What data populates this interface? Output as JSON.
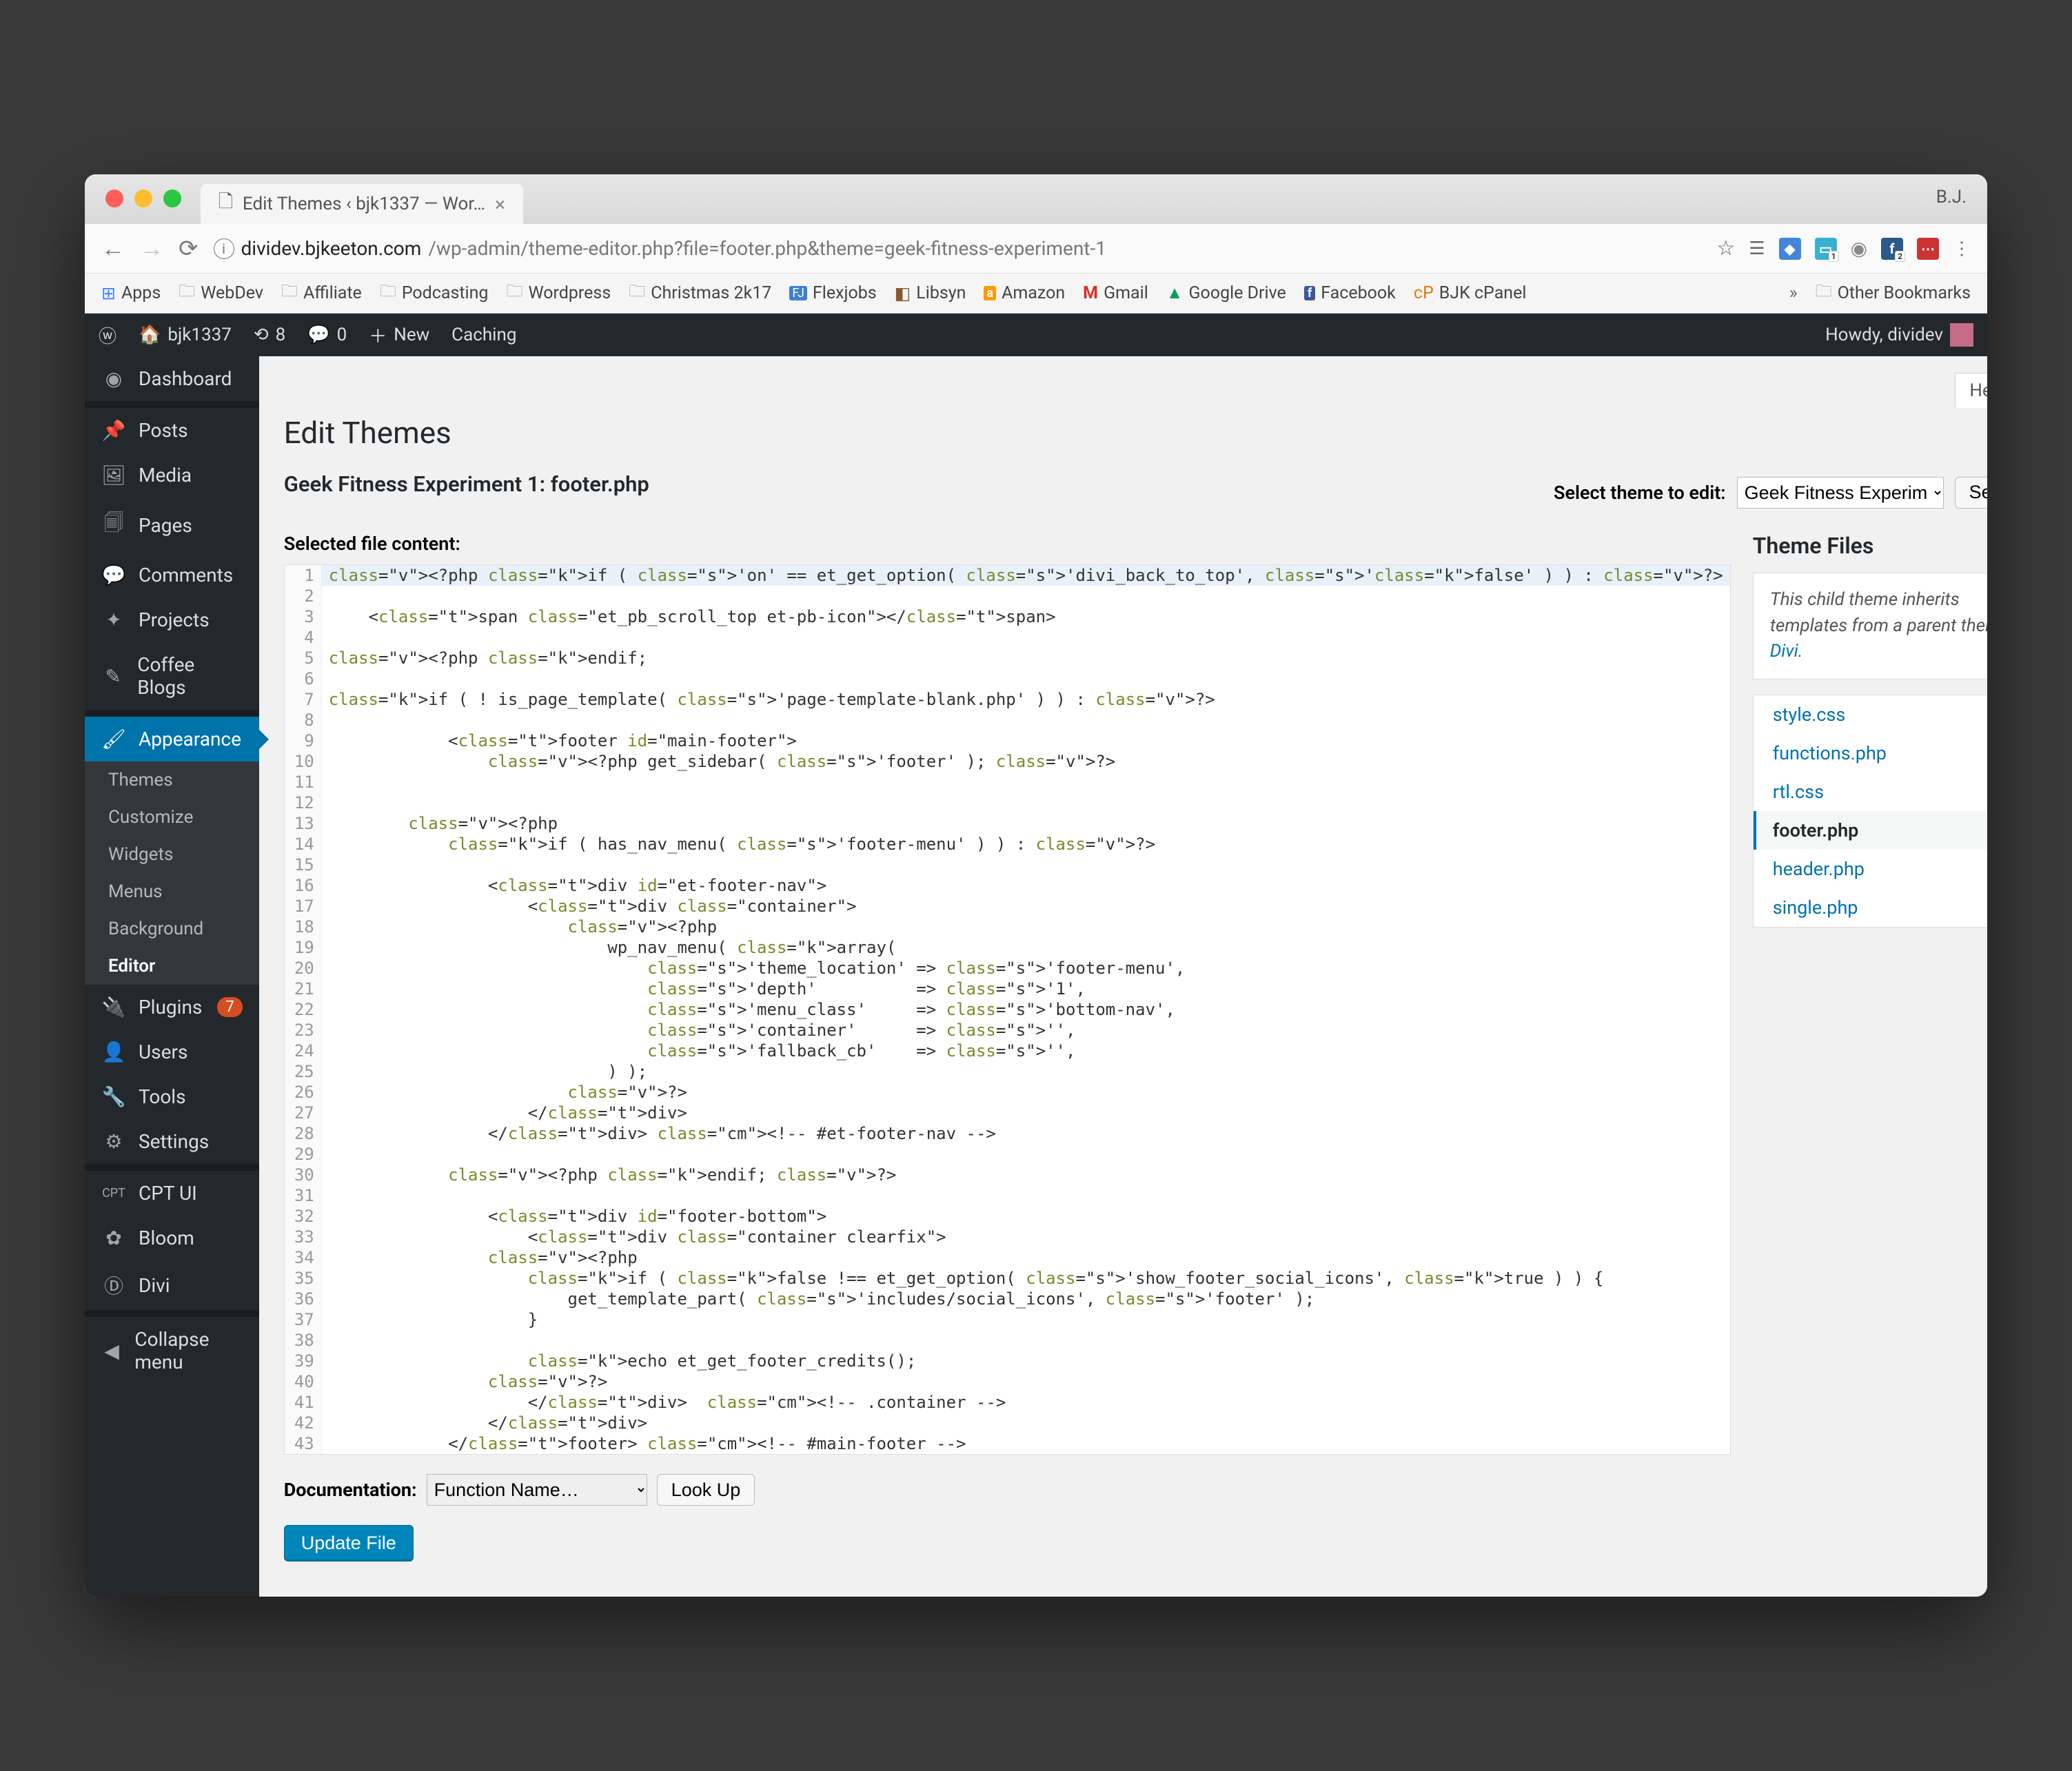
{
  "browser": {
    "tab_title": "Edit Themes ‹ bjk1337 — Wor…",
    "profile": "B.J.",
    "url_host": "dividev.bjkeeton.com",
    "url_path": "/wp-admin/theme-editor.php?file=footer.php&theme=geek-fitness-experiment-1",
    "bookmarks": [
      "Apps",
      "WebDev",
      "Affiliate",
      "Podcasting",
      "Wordpress",
      "Christmas 2k17",
      "Flexjobs",
      "Libsyn",
      "Amazon",
      "Gmail",
      "Google Drive",
      "Facebook",
      "BJK cPanel"
    ],
    "other_bookmarks": "Other Bookmarks"
  },
  "wpbar": {
    "site": "bjk1337",
    "updates": "8",
    "comments": "0",
    "new": "New",
    "caching": "Caching",
    "howdy": "Howdy, dividev"
  },
  "sidebar": {
    "items": [
      "Dashboard",
      "Posts",
      "Media",
      "Pages",
      "Comments",
      "Projects",
      "Coffee Blogs",
      "Appearance",
      "Plugins",
      "Users",
      "Tools",
      "Settings",
      "CPT UI",
      "Bloom",
      "Divi",
      "Collapse menu"
    ],
    "plugins_badge": "7",
    "appearance_sub": [
      "Themes",
      "Customize",
      "Widgets",
      "Menus",
      "Background",
      "Editor"
    ]
  },
  "content": {
    "help": "Help",
    "page_title": "Edit Themes",
    "subtitle": "Geek Fitness Experiment 1: footer.php",
    "select_label": "Select theme to edit:",
    "select_value": "Geek Fitness Experim",
    "select_btn": "Select",
    "sfc_label": "Selected file content:",
    "doc_label": "Documentation:",
    "doc_select": "Function Name…",
    "lookup": "Look Up",
    "update": "Update File"
  },
  "files": {
    "heading": "Theme Files",
    "inherit_text": "This child theme inherits templates from a parent theme, ",
    "inherit_link": "Divi",
    "list": [
      "style.css",
      "functions.php",
      "rtl.css",
      "footer.php",
      "header.php",
      "single.php"
    ],
    "current": "footer.php"
  },
  "code_lines": [
    "<?php if ( 'on' == et_get_option( 'divi_back_to_top', 'false' ) ) : ?>",
    "",
    "    <span class=\"et_pb_scroll_top et-pb-icon\"></span>",
    "",
    "<?php endif;",
    "",
    "if ( ! is_page_template( 'page-template-blank.php' ) ) : ?>",
    "",
    "            <footer id=\"main-footer\">",
    "                <?php get_sidebar( 'footer' ); ?>",
    "",
    "",
    "        <?php",
    "            if ( has_nav_menu( 'footer-menu' ) ) : ?>",
    "",
    "                <div id=\"et-footer-nav\">",
    "                    <div class=\"container\">",
    "                        <?php",
    "                            wp_nav_menu( array(",
    "                                'theme_location' => 'footer-menu',",
    "                                'depth'          => '1',",
    "                                'menu_class'     => 'bottom-nav',",
    "                                'container'      => '',",
    "                                'fallback_cb'    => '',",
    "                            ) );",
    "                        ?>",
    "                    </div>",
    "                </div> <!-- #et-footer-nav -->",
    "",
    "            <?php endif; ?>",
    "",
    "                <div id=\"footer-bottom\">",
    "                    <div class=\"container clearfix\">",
    "                <?php",
    "                    if ( false !== et_get_option( 'show_footer_social_icons', true ) ) {",
    "                        get_template_part( 'includes/social_icons', 'footer' );",
    "                    }",
    "",
    "                    echo et_get_footer_credits();",
    "                ?>",
    "                    </div>  <!-- .container -->",
    "                </div>",
    "            </footer> <!-- #main-footer -->"
  ]
}
